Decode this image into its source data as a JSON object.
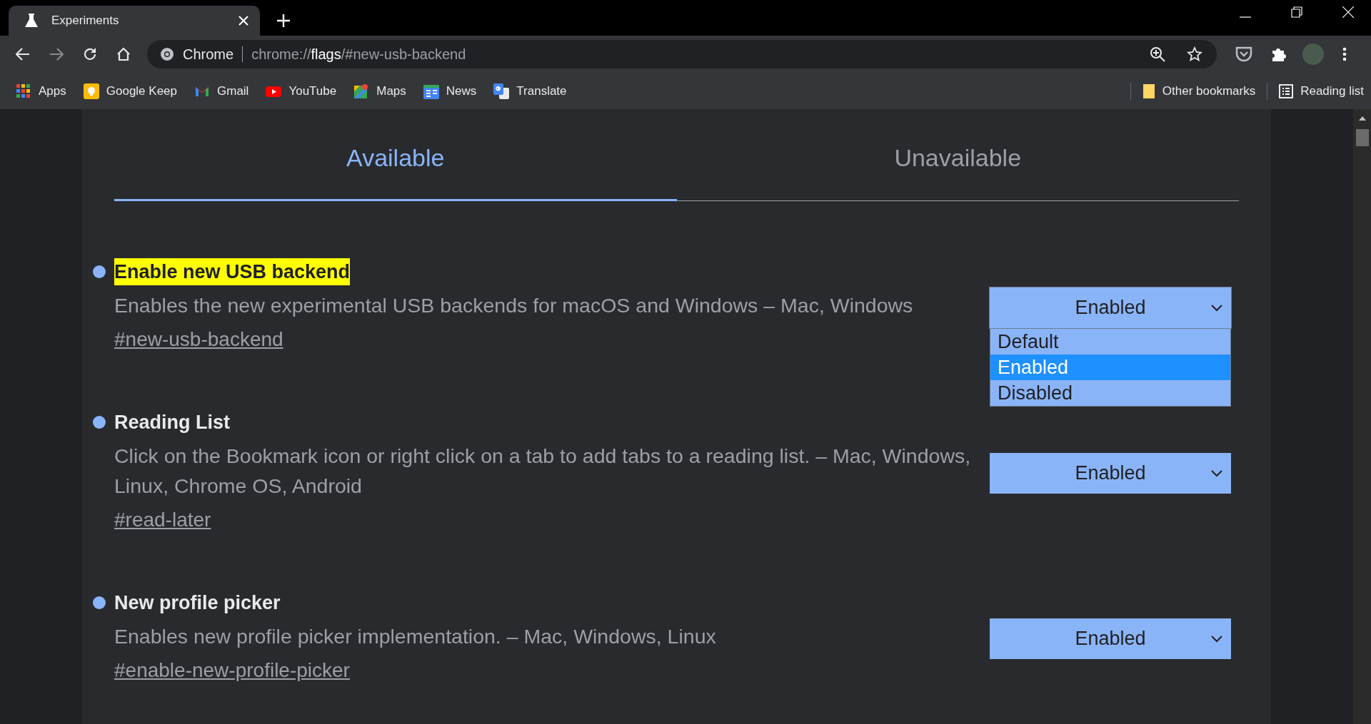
{
  "browser_tab": {
    "title": "Experiments",
    "selected": true
  },
  "toolbar": {
    "forward_disabled": true,
    "site_label": "Chrome",
    "url_parts": [
      {
        "text": "chrome://",
        "emphasized": false
      },
      {
        "text": "flags",
        "emphasized": true
      },
      {
        "text": "/#new-usb-backend",
        "emphasized": false
      }
    ]
  },
  "bookmarks": [
    {
      "label": "Apps",
      "kind": "apps"
    },
    {
      "label": "Google Keep",
      "kind": "keep"
    },
    {
      "label": "Gmail",
      "kind": "gmail"
    },
    {
      "label": "YouTube",
      "kind": "youtube"
    },
    {
      "label": "Maps",
      "kind": "maps"
    },
    {
      "label": "News",
      "kind": "news"
    },
    {
      "label": "Translate",
      "kind": "translate"
    }
  ],
  "other_bookmarks": "Other bookmarks",
  "reading_list": "Reading list",
  "page_tabs": [
    {
      "label": "Available",
      "selected": true
    },
    {
      "label": "Unavailable",
      "selected": false
    }
  ],
  "experiments": [
    {
      "title": "Enable new USB backend",
      "highlighted": true,
      "description": "Enables the new experimental USB backends for macOS and Windows – Mac, Windows",
      "link": "#new-usb-backend",
      "value": "Enabled",
      "open": true,
      "options": [
        {
          "label": "Default",
          "selected": false
        },
        {
          "label": "Enabled",
          "selected": true
        },
        {
          "label": "Disabled",
          "selected": false
        }
      ]
    },
    {
      "title": "Reading List",
      "highlighted": false,
      "description": "Click on the Bookmark icon or right click on a tab to add tabs to a reading list. – Mac, Windows, Linux, Chrome OS, Android",
      "link": "#read-later",
      "value": "Enabled",
      "open": false
    },
    {
      "title": "New profile picker",
      "highlighted": false,
      "description": "Enables new profile picker implementation. – Mac, Windows, Linux",
      "link": "#enable-new-profile-picker",
      "value": "Enabled",
      "open": false
    }
  ]
}
